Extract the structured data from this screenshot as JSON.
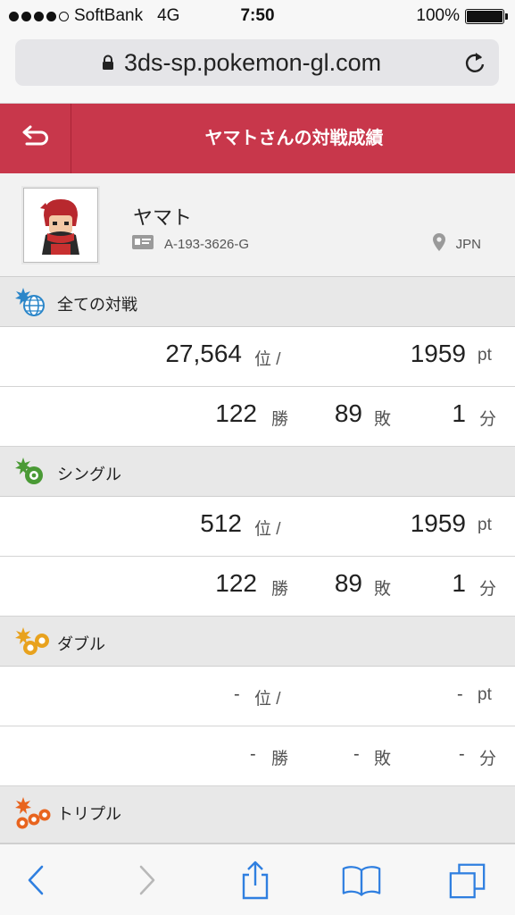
{
  "status_bar": {
    "carrier": "SoftBank",
    "network": "4G",
    "time": "7:50",
    "battery": "100%",
    "signal_bars_filled": 4,
    "signal_bars_total": 5
  },
  "browser": {
    "url": "3ds-sp.pokemon-gl.com"
  },
  "header": {
    "title": "ヤマトさんの対戦成績",
    "back_icon": "return-arrow-icon",
    "color": "#c8374b"
  },
  "profile": {
    "name": "ヤマト",
    "friend_code": "A-193-3626-G",
    "country": "JPN"
  },
  "sections": [
    {
      "label": "全ての対戦",
      "icon": "globe-battle-icon",
      "rank": "27,564",
      "rank_unit": "位 /",
      "rating": "1959",
      "rating_unit": "pt",
      "wins": "122",
      "wins_unit": "勝",
      "losses": "89",
      "losses_unit": "敗",
      "draws": "1",
      "draws_unit": "分"
    },
    {
      "label": "シングル",
      "icon": "single-battle-icon",
      "rank": "512",
      "rank_unit": "位 /",
      "rating": "1959",
      "rating_unit": "pt",
      "wins": "122",
      "wins_unit": "勝",
      "losses": "89",
      "losses_unit": "敗",
      "draws": "1",
      "draws_unit": "分"
    },
    {
      "label": "ダブル",
      "icon": "double-battle-icon",
      "rank": "-",
      "rank_unit": "位 /",
      "rating": "-",
      "rating_unit": "pt",
      "wins": "-",
      "wins_unit": "勝",
      "losses": "-",
      "losses_unit": "敗",
      "draws": "-",
      "draws_unit": "分"
    },
    {
      "label": "トリプル",
      "icon": "triple-battle-icon"
    }
  ],
  "toolbar": {
    "back_icon": "chevron-left-icon",
    "forward_icon": "chevron-right-icon",
    "share_icon": "share-icon",
    "bookmarks_icon": "book-icon",
    "tabs_icon": "tabs-icon"
  }
}
